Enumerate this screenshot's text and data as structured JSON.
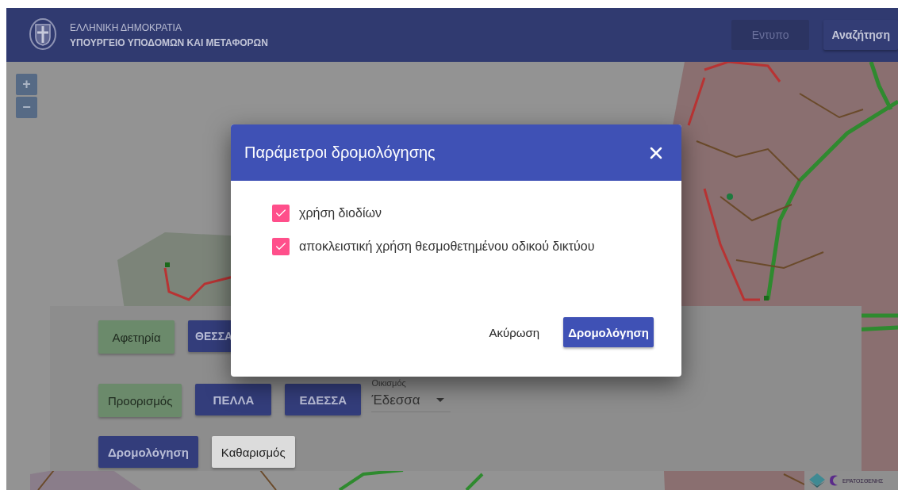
{
  "header": {
    "title": "ΕΛΛΗΝΙΚΗ ΔΗΜΟΚΡΑΤΙΑ",
    "subtitle": "ΥΠΟΥΡΓΕΙΟ ΥΠΟΔΟΜΩΝ ΚΑΙ ΜΕΤΑΦΟΡΩΝ",
    "buttons": [
      {
        "label": "Εντυπο",
        "disabled": true
      },
      {
        "label": "Αναζήτηση",
        "disabled": false
      }
    ]
  },
  "zoom_controls": [
    "+",
    "−"
  ],
  "route_panel": {
    "rows": [
      {
        "items": [
          {
            "kind": "tag",
            "text": "Αφετηρία"
          },
          {
            "kind": "partial",
            "text": "ΘΕΣΣΑ"
          }
        ]
      },
      {
        "items": [
          {
            "kind": "tag",
            "text": "Προορισμός"
          },
          {
            "kind": "primary",
            "text": "ΠΕΛΛΑ"
          },
          {
            "kind": "primary",
            "text": "ΕΔΕΣΣΑ"
          },
          {
            "kind": "select",
            "label": "Οικισμός",
            "value": "Έδεσσα"
          }
        ]
      },
      {
        "items": [
          {
            "kind": "primary",
            "text": "Δρομολόγηση"
          },
          {
            "kind": "plain",
            "text": "Καθαρισμός"
          }
        ]
      }
    ]
  },
  "attribution": {
    "text": "ΕΡΑΤΟΣΘΕΝΗΣ"
  },
  "dialog": {
    "title": "Παράμετροι δρομολόγησης",
    "options": [
      {
        "label": "χρήση διοδίων",
        "checked": true
      },
      {
        "label": "αποκλειστική χρήση θεσμοθετημένου οδικού δικτύου",
        "checked": true
      }
    ],
    "buttons": [
      {
        "kind": "text",
        "label": "Ακύρωση"
      },
      {
        "kind": "primary",
        "label": "Δρομολόγηση"
      }
    ]
  }
}
